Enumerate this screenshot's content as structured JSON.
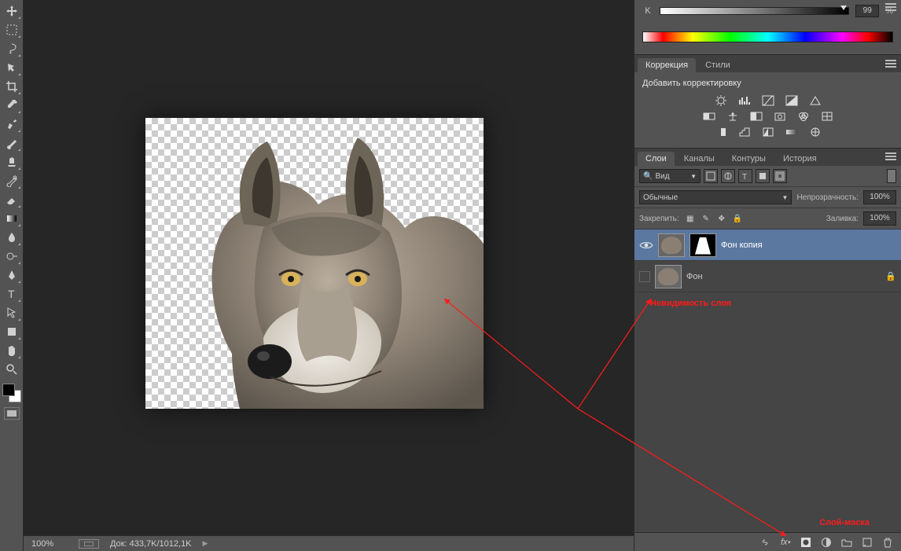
{
  "color_panel": {
    "channel_label": "K",
    "value": "99",
    "percent": "%"
  },
  "adjustments": {
    "tab_correction": "Коррекция",
    "tab_styles": "Стили",
    "add_label": "Добавить корректировку"
  },
  "layers_tabs": {
    "layers": "Слои",
    "channels": "Каналы",
    "paths": "Контуры",
    "history": "История"
  },
  "filter_row": {
    "kind_label": "Вид"
  },
  "blend_row": {
    "mode": "Обычные",
    "opacity_label": "Непрозрачность:",
    "opacity_value": "100%"
  },
  "lock_row": {
    "label": "Закрепить:",
    "fill_label": "Заливка:",
    "fill_value": "100%"
  },
  "layers": {
    "layer1_name": "Фон копия",
    "layer2_name": "Фон"
  },
  "annotations": {
    "visibility": "Невидимость слоя",
    "mask": "Слой-маска"
  },
  "statusbar": {
    "zoom": "100%",
    "doc": "Док: 433,7K/1012,1K"
  }
}
